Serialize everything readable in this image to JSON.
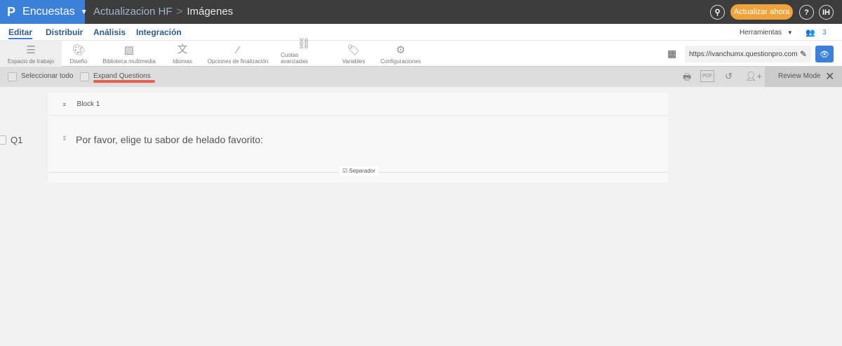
{
  "header": {
    "brand": "Encuestas",
    "breadcrumb": [
      "Actualizacion HF",
      "Imágenes"
    ],
    "update_button": "Actualizar ahora",
    "help": "?",
    "avatar": "IH",
    "brand_color": "#3b80d9",
    "accent": "#f0a23b"
  },
  "menu": {
    "items": [
      "Editar",
      "Distribuir",
      "Análisis",
      "Integración"
    ],
    "tools_label": "Herramientas",
    "collaborators": "3"
  },
  "toolbar": {
    "items": [
      {
        "label": "Espacio de trabajo",
        "icon": "list-icon"
      },
      {
        "label": "Diseño",
        "icon": "palette-icon"
      },
      {
        "label": "Biblioteca multimedia",
        "icon": "image-icon"
      },
      {
        "label": "Idiomas",
        "icon": "translate-icon"
      },
      {
        "label": "Opciones de finalización",
        "icon": "magic-wand-icon"
      },
      {
        "label": "Cuotas avanzadas",
        "icon": "link-icon"
      },
      {
        "label": "Variables",
        "icon": "tag-icon"
      },
      {
        "label": "Configuraciones",
        "icon": "gear-icon"
      }
    ],
    "url": "https://ivanchumx.questionpro.com"
  },
  "actions": {
    "select_all": "Seleccionar todo",
    "expand": "Expand Questions",
    "pdf": "PDF",
    "review_mode": "Review Mode"
  },
  "survey": {
    "block": "Block 1",
    "question_number": "Q1",
    "question_text": "Por favor, elige tu sabor de helado favorito:",
    "separator": "Separador"
  }
}
